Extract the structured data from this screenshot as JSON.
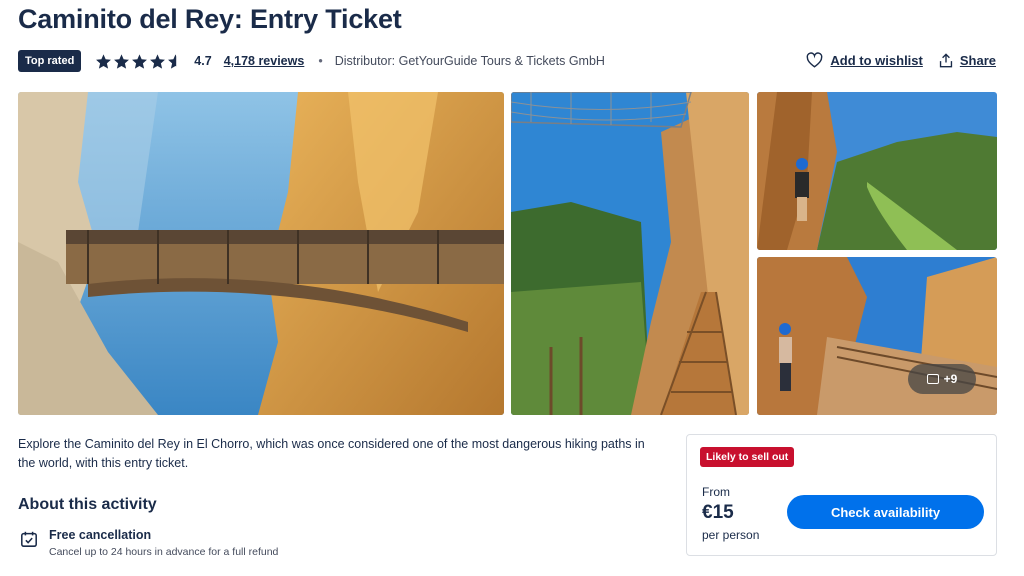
{
  "page": {
    "title": "Caminito del Rey: Entry Ticket"
  },
  "meta": {
    "badge": "Top rated",
    "rating": "4.7",
    "rating_fraction": 0.94,
    "stars_full": 4,
    "reviews": "4,178 reviews",
    "separator": "•",
    "distributor": "Distributor: GetYourGuide Tours & Tickets GmbH"
  },
  "actions": {
    "wishlist": "Add to wishlist",
    "share": "Share"
  },
  "gallery": {
    "more_count": "+9"
  },
  "description": "Explore the Caminito del Rey in El Chorro, which was once considered one of the most dangerous hiking paths in the world, with this entry ticket.",
  "about": {
    "heading": "About this activity",
    "features": [
      {
        "title": "Free cancellation",
        "subtitle": "Cancel up to 24 hours in advance for a full refund"
      }
    ]
  },
  "booking": {
    "badge": "Likely to sell out",
    "from_label": "From",
    "price": "€15",
    "per_label": "per person",
    "cta": "Check availability"
  },
  "colors": {
    "brand_navy": "#1a2b49",
    "cta_blue": "#0071eb",
    "alert_red": "#c8102e"
  }
}
